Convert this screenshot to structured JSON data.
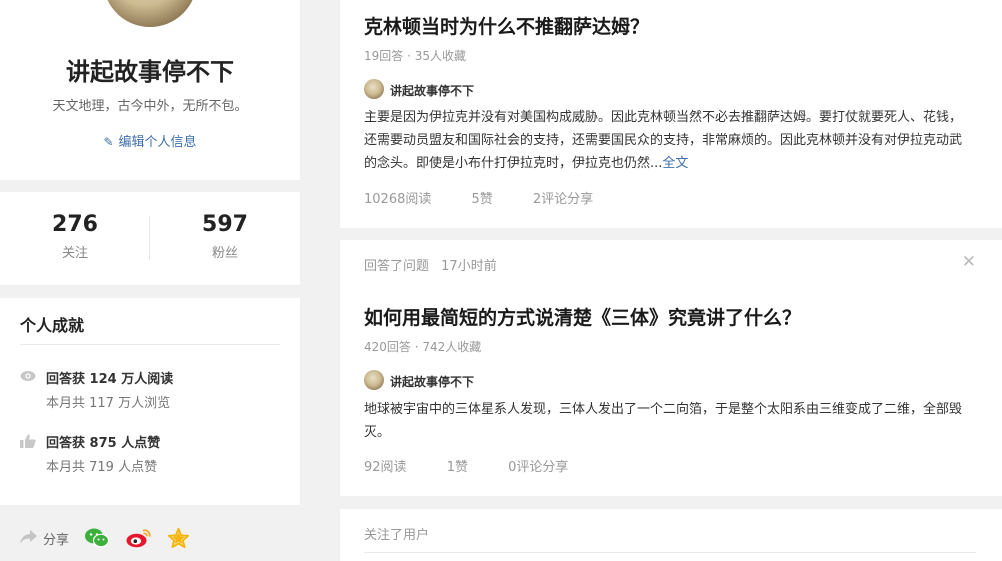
{
  "profile": {
    "name": "讲起故事停不下",
    "bio": "天文地理，古今中外，无所不包。",
    "edit_label": "编辑个人信息"
  },
  "stats": {
    "following_count": "276",
    "following_label": "关注",
    "followers_count": "597",
    "followers_label": "粉丝"
  },
  "achievements": {
    "title": "个人成就",
    "items": [
      {
        "icon": "eye-icon",
        "main": "回答获 124 万人阅读",
        "sub": "本月共 117 万人浏览"
      },
      {
        "icon": "thumbs-up-icon",
        "main": "回答获 875 人点赞",
        "sub": "本月共 719 人点赞"
      }
    ]
  },
  "share": {
    "label": "分享",
    "icons": [
      "share-arrow-icon",
      "wechat-icon",
      "weibo-icon",
      "star-icon"
    ],
    "colors": {
      "wechat": "#3bb03b",
      "weibo": "#e6162d",
      "star": "#f5b400"
    }
  },
  "feed": [
    {
      "title": "克林顿当时为什么不推翻萨达姆？",
      "meta": "19回答 · 35人收藏",
      "author": "讲起故事停不下",
      "excerpt": "主要是因为伊拉克并没有对美国构成威胁。因此克林顿当然不必去推翻萨达姆。要打仗就要死人、花钱，还需要动员盟友和国际社会的支持，还需要国民众的支持，非常麻烦的。因此克林顿并没有对伊拉克动武的念头。即使是小布什打伊拉克时，伊拉克也仍然...",
      "more": "全文",
      "reads": "10268阅读",
      "likes": "5赞",
      "comments": "2评论",
      "share": "分享"
    },
    {
      "activity": "回答了问题",
      "time": "17小时前",
      "title": "如何用最简短的方式说清楚《三体》究竟讲了什么？",
      "meta": "420回答 · 742人收藏",
      "author": "讲起故事停不下",
      "excerpt": "地球被宇宙中的三体星系人发现，三体人发出了一个二向箔，于是整个太阳系由三维变成了二维，全部毁灭。",
      "reads": "92阅读",
      "likes": "1赞",
      "comments": "0评论",
      "share": "分享"
    },
    {
      "activity": "关注了用户"
    }
  ],
  "colors": {
    "link": "#3e6fa8",
    "muted": "#999999",
    "background": "#f1f1f1"
  }
}
